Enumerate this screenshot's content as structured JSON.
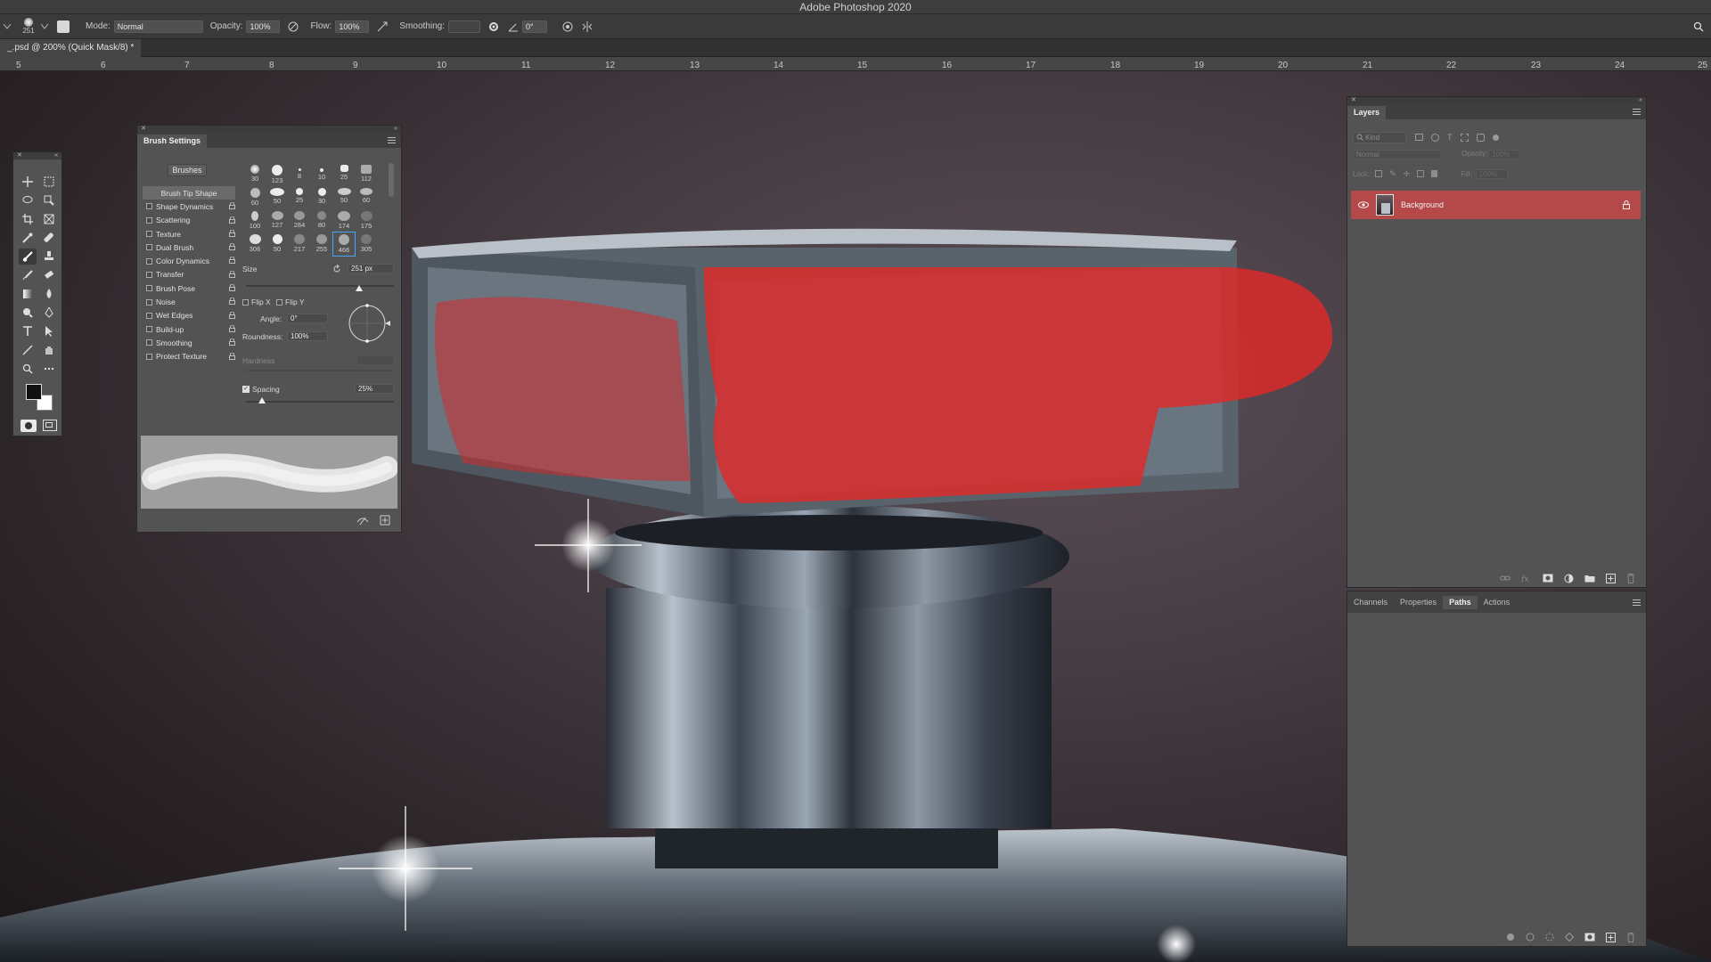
{
  "app": {
    "title": "Adobe Photoshop 2020"
  },
  "options_bar": {
    "brush_size": "251",
    "mode_label": "Mode:",
    "mode_value": "Normal",
    "opacity_label": "Opacity:",
    "opacity_value": "100%",
    "flow_label": "Flow:",
    "flow_value": "100%",
    "smoothing_label": "Smoothing:",
    "smoothing_value": "",
    "angle_value": "0°"
  },
  "document": {
    "tab_title": "_.psd @ 200% (Quick Mask/8) *"
  },
  "ruler": {
    "ticks": [
      "5",
      "6",
      "7",
      "8",
      "9",
      "10",
      "11",
      "12",
      "13",
      "14",
      "15",
      "16",
      "17",
      "18",
      "19",
      "20",
      "21",
      "22",
      "23",
      "24",
      "25"
    ]
  },
  "brush_settings": {
    "title": "Brush Settings",
    "brushes_button": "Brushes",
    "options": [
      {
        "label": "Brush Tip Shape",
        "checkbox": false,
        "lock": false,
        "selected": true
      },
      {
        "label": "Shape Dynamics",
        "checkbox": true,
        "lock": true
      },
      {
        "label": "Scattering",
        "checkbox": true,
        "lock": true
      },
      {
        "label": "Texture",
        "checkbox": true,
        "lock": true
      },
      {
        "label": "Dual Brush",
        "checkbox": true,
        "lock": true
      },
      {
        "label": "Color Dynamics",
        "checkbox": true,
        "lock": true
      },
      {
        "label": "Transfer",
        "checkbox": true,
        "lock": true
      },
      {
        "label": "Brush Pose",
        "checkbox": true,
        "lock": true
      },
      {
        "label": "Noise",
        "checkbox": true,
        "lock": true
      },
      {
        "label": "Wet Edges",
        "checkbox": true,
        "lock": true
      },
      {
        "label": "Build-up",
        "checkbox": true,
        "lock": true
      },
      {
        "label": "Smoothing",
        "checkbox": true,
        "lock": true
      },
      {
        "label": "Protect Texture",
        "checkbox": true,
        "lock": true
      }
    ],
    "brush_tips": [
      {
        "size": "30"
      },
      {
        "size": "123"
      },
      {
        "size": "8"
      },
      {
        "size": "10"
      },
      {
        "size": "25"
      },
      {
        "size": "112"
      },
      {
        "size": "60"
      },
      {
        "size": "50"
      },
      {
        "size": "25"
      },
      {
        "size": "30"
      },
      {
        "size": "50"
      },
      {
        "size": "60"
      },
      {
        "size": "100"
      },
      {
        "size": "127"
      },
      {
        "size": "284"
      },
      {
        "size": "80"
      },
      {
        "size": "174"
      },
      {
        "size": "175"
      },
      {
        "size": "306"
      },
      {
        "size": "50"
      },
      {
        "size": "217"
      },
      {
        "size": "255"
      },
      {
        "size": "466",
        "selected": true
      },
      {
        "size": "305"
      }
    ],
    "size_label": "Size",
    "size_value": "251 px",
    "flip_x": "Flip X",
    "flip_y": "Flip Y",
    "angle_label": "Angle:",
    "angle_value": "0°",
    "roundness_label": "Roundness:",
    "roundness_value": "100%",
    "hardness_label": "Hardness",
    "spacing_label": "Spacing",
    "spacing_value": "25%",
    "spacing_checked": true
  },
  "layers_panel": {
    "title": "Layers",
    "kind_placeholder": "Kind",
    "blend_mode": "Normal",
    "opacity_label": "Opacity:",
    "opacity_value": "100%",
    "lock_label": "Lock:",
    "fill_label": "Fill:",
    "fill_value": "100%",
    "layers": [
      {
        "name": "Background",
        "visible": true,
        "locked": true
      }
    ]
  },
  "bottom_panel": {
    "tabs": [
      "Channels",
      "Properties",
      "Paths",
      "Actions"
    ],
    "active_tab": "Paths"
  },
  "colors": {
    "foreground": "#111111",
    "background": "#ffffff",
    "quick_mask": "#e02828",
    "selected_layer": "#b54848"
  }
}
